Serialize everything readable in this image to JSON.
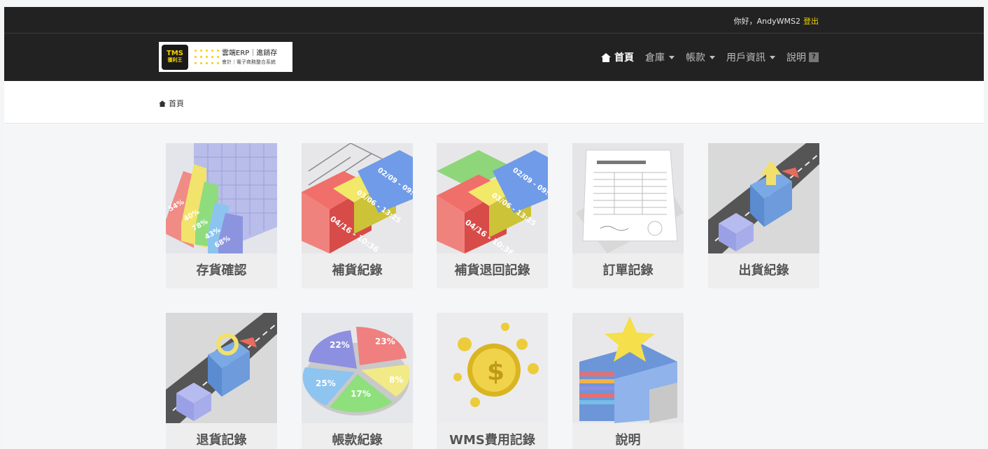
{
  "topbar": {
    "greeting": "你好，AndyWMS2",
    "logout": "登出"
  },
  "logo": {
    "mark_line1": "TMS",
    "mark_line2": "獲利王",
    "text_line1": "雲端ERP｜進銷存",
    "text_line2": "會計｜電子商務整合系統"
  },
  "nav": {
    "items": [
      {
        "label": "首頁",
        "icon": "home-icon"
      },
      {
        "label": "倉庫",
        "dropdown": true
      },
      {
        "label": "帳款",
        "dropdown": true
      },
      {
        "label": "用戶資訊",
        "dropdown": true
      },
      {
        "label": "說明",
        "badge": "?"
      }
    ]
  },
  "breadcrumb": {
    "label": "首頁"
  },
  "tiles": [
    {
      "label": "存貨確認",
      "icon": "inventory-bars-icon"
    },
    {
      "label": "補貨紀錄",
      "icon": "replenish-containers-icon"
    },
    {
      "label": "補貨退回記錄",
      "icon": "replenish-return-containers-icon"
    },
    {
      "label": "訂單記錄",
      "icon": "order-document-icon"
    },
    {
      "label": "出貨紀錄",
      "icon": "shipping-truck-icon"
    },
    {
      "label": "退貨記錄",
      "icon": "return-truck-icon"
    },
    {
      "label": "帳款紀錄",
      "icon": "pie-chart-icon"
    },
    {
      "label": "WMS費用記錄",
      "icon": "coin-icon"
    },
    {
      "label": "說明",
      "icon": "book-star-icon"
    }
  ],
  "colors": {
    "accent_yellow": "#f3d200",
    "bar_dark": "#222222",
    "tile_bg": "#eeeeee"
  }
}
